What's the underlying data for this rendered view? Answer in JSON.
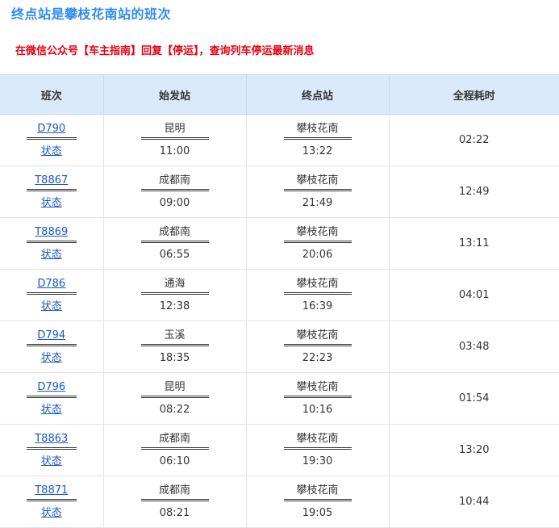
{
  "page": {
    "title": "终点站是攀枝花南站的班次",
    "notice": "在微信公众号【车主指南】回复【停运】，查询列车停运最新消息"
  },
  "table": {
    "headers": [
      "班次",
      "始发站",
      "终点站",
      "全程耗时"
    ],
    "rows": [
      {
        "train": "D790",
        "status": "状态",
        "from": "昆明",
        "depart": "11:00",
        "to": "攀枝花南",
        "arrive": "13:22",
        "duration": "02:22"
      },
      {
        "train": "T8867",
        "status": "状态",
        "from": "成都南",
        "depart": "09:00",
        "to": "攀枝花南",
        "arrive": "21:49",
        "duration": "12:49"
      },
      {
        "train": "T8869",
        "status": "状态",
        "from": "成都南",
        "depart": "06:55",
        "to": "攀枝花南",
        "arrive": "20:06",
        "duration": "13:11"
      },
      {
        "train": "D786",
        "status": "状态",
        "from": "通海",
        "depart": "12:38",
        "to": "攀枝花南",
        "arrive": "16:39",
        "duration": "04:01"
      },
      {
        "train": "D794",
        "status": "状态",
        "from": "玉溪",
        "depart": "18:35",
        "to": "攀枝花南",
        "arrive": "22:23",
        "duration": "03:48"
      },
      {
        "train": "D796",
        "status": "状态",
        "from": "昆明",
        "depart": "08:22",
        "to": "攀枝花南",
        "arrive": "10:16",
        "duration": "01:54"
      },
      {
        "train": "T8863",
        "status": "状态",
        "from": "成都南",
        "depart": "06:10",
        "to": "攀枝花南",
        "arrive": "19:30",
        "duration": "13:20"
      },
      {
        "train": "T8871",
        "status": "状态",
        "from": "成都南",
        "depart": "08:21",
        "to": "攀枝花南",
        "arrive": "19:05",
        "duration": "10:44"
      }
    ]
  }
}
